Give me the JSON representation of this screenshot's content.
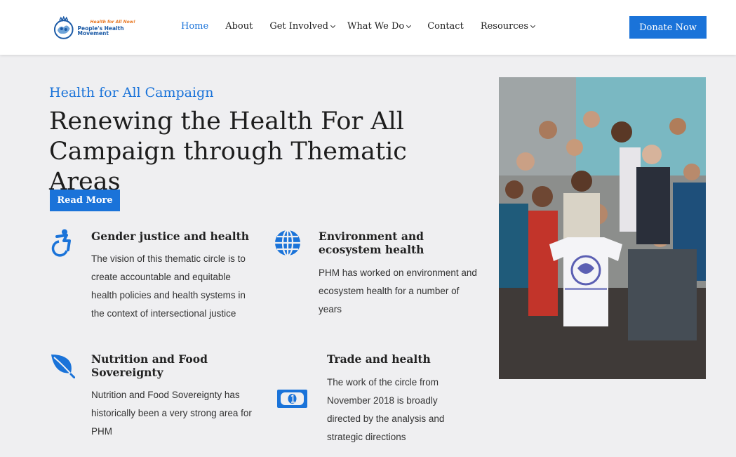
{
  "header": {
    "logo": {
      "tagline": "Health for All Now!",
      "name": "People's Health Movement"
    },
    "nav": [
      {
        "label": "Home",
        "active": true,
        "dropdown": false
      },
      {
        "label": "About",
        "active": false,
        "dropdown": false
      },
      {
        "label": "Get Involved",
        "active": false,
        "dropdown": true
      },
      {
        "label": "What We Do",
        "active": false,
        "dropdown": true
      },
      {
        "label": "Contact",
        "active": false,
        "dropdown": false
      },
      {
        "label": "Resources",
        "active": false,
        "dropdown": true
      }
    ],
    "donate_label": "Donate Now"
  },
  "hero": {
    "eyebrow": "Health for All Campaign",
    "headline": "Renewing the Health For All Campaign through Thematic Areas",
    "read_more_label": "Read More"
  },
  "features": [
    {
      "icon": "accessibility-icon",
      "title": "Gender justice and health",
      "description": "The vision of this  thematic circle is to create accountable and equitable health policies and health systems in the context of intersectional justice"
    },
    {
      "icon": "globe-icon",
      "title": "Environment and ecosystem health",
      "description": "PHM has worked on environment and ecosystem health for a number of years"
    },
    {
      "icon": "leaf-icon",
      "title": "Nutrition and Food Sovereignty",
      "description": "Nutrition and Food Sovereignty has historically been a very strong area for PHM"
    },
    {
      "icon": "money-bill-icon",
      "title": "Trade and health",
      "description": "The work of the circle from November 2018 is broadly directed by the analysis and strategic directions"
    }
  ],
  "colors": {
    "accent": "#1a73d9",
    "background": "#efeff1",
    "header": "#ffffff"
  }
}
